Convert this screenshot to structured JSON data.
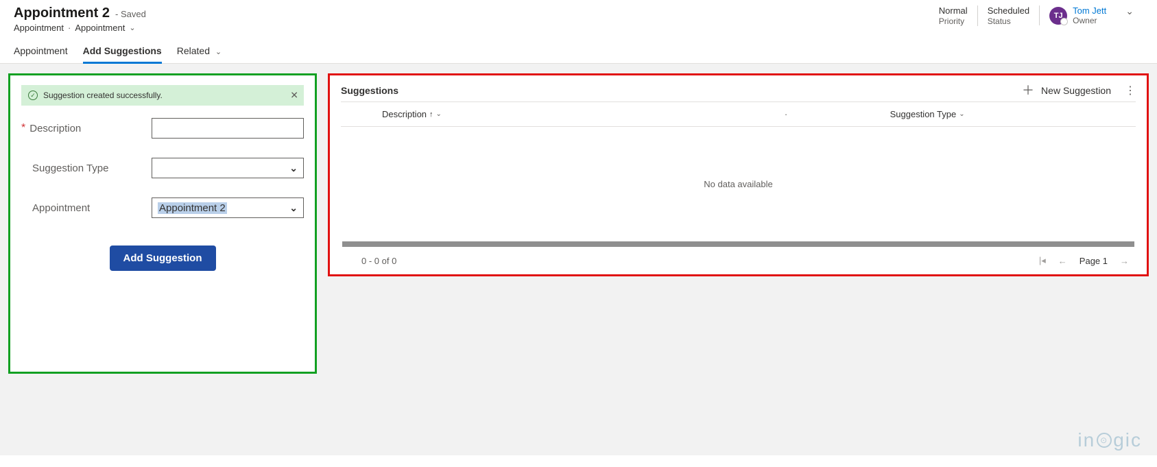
{
  "header": {
    "title": "Appointment 2",
    "saved": "- Saved",
    "crumb1": "Appointment",
    "crumb2": "Appointment",
    "priority_value": "Normal",
    "priority_label": "Priority",
    "status_value": "Scheduled",
    "status_label": "Status",
    "owner_initials": "TJ",
    "owner_name": "Tom Jett",
    "owner_label": "Owner"
  },
  "tabs": {
    "t0": "Appointment",
    "t1": "Add Suggestions",
    "t2": "Related"
  },
  "form": {
    "success": "Suggestion created successfully.",
    "description_label": "Description",
    "type_label": "Suggestion Type",
    "appointment_label": "Appointment",
    "appointment_value": "Appointment 2",
    "button": "Add Suggestion"
  },
  "grid": {
    "title": "Suggestions",
    "new_label": "New Suggestion",
    "col_description": "Description",
    "col_type": "Suggestion Type",
    "empty": "No data available",
    "range": "0 - 0 of 0",
    "page": "Page 1"
  },
  "watermark": {
    "p1": "in",
    "p2": "gic"
  }
}
